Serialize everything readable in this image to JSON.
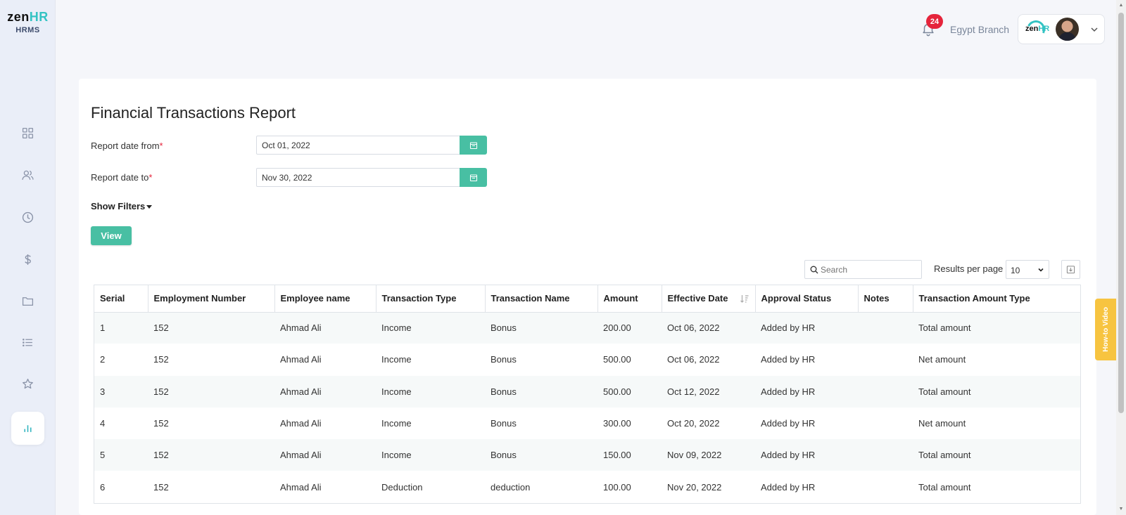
{
  "app": {
    "logo_main": "zen",
    "logo_accent": "HR",
    "logo_sub": "HRMS"
  },
  "sidebar": {
    "items": [
      {
        "icon": "dashboard-icon"
      },
      {
        "icon": "users-icon"
      },
      {
        "icon": "clock-icon"
      },
      {
        "icon": "dollar-icon"
      },
      {
        "icon": "folder-icon"
      },
      {
        "icon": "list-icon"
      },
      {
        "icon": "star-icon"
      },
      {
        "icon": "reports-chart-icon",
        "active": true
      }
    ]
  },
  "header": {
    "notification_count": "24",
    "branch": "Egypt Branch",
    "company_logo_main": "zen",
    "company_logo_accent": "HR"
  },
  "report": {
    "title": "Financial Transactions Report",
    "date_from_label": "Report date from",
    "date_from_value": "Oct 01, 2022",
    "date_to_label": "Report date to",
    "date_to_value": "Nov 30, 2022",
    "required_mark": "*",
    "show_filters_label": "Show Filters",
    "view_button_label": "View"
  },
  "table_controls": {
    "search_placeholder": "Search",
    "results_per_page_label": "Results per page",
    "results_per_page_value": "10"
  },
  "table": {
    "columns": [
      "Serial",
      "Employment Number",
      "Employee name",
      "Transaction Type",
      "Transaction Name",
      "Amount",
      "Effective Date",
      "Approval Status",
      "Notes",
      "Transaction Amount Type"
    ],
    "rows": [
      [
        "1",
        "152",
        "Ahmad Ali",
        "Income",
        "Bonus",
        "200.00",
        "Oct 06, 2022",
        "Added by HR",
        "",
        "Total amount"
      ],
      [
        "2",
        "152",
        "Ahmad Ali",
        "Income",
        "Bonus",
        "500.00",
        "Oct 06, 2022",
        "Added by HR",
        "",
        "Net amount"
      ],
      [
        "3",
        "152",
        "Ahmad Ali",
        "Income",
        "Bonus",
        "500.00",
        "Oct 12, 2022",
        "Added by HR",
        "",
        "Total amount"
      ],
      [
        "4",
        "152",
        "Ahmad Ali",
        "Income",
        "Bonus",
        "300.00",
        "Oct 20, 2022",
        "Added by HR",
        "",
        "Net amount"
      ],
      [
        "5",
        "152",
        "Ahmad Ali",
        "Income",
        "Bonus",
        "150.00",
        "Nov 09, 2022",
        "Added by HR",
        "",
        "Total amount"
      ],
      [
        "6",
        "152",
        "Ahmad Ali",
        "Deduction",
        "deduction",
        "100.00",
        "Nov 20, 2022",
        "Added by HR",
        "",
        "Total amount"
      ]
    ]
  },
  "howto_tab": "How-to Video",
  "colors": {
    "accent": "#48bfa3",
    "brand_teal": "#33c3c3",
    "badge_red": "#e5243b",
    "howto_yellow": "#f7c440",
    "sidebar_bg": "#eaeef8"
  }
}
